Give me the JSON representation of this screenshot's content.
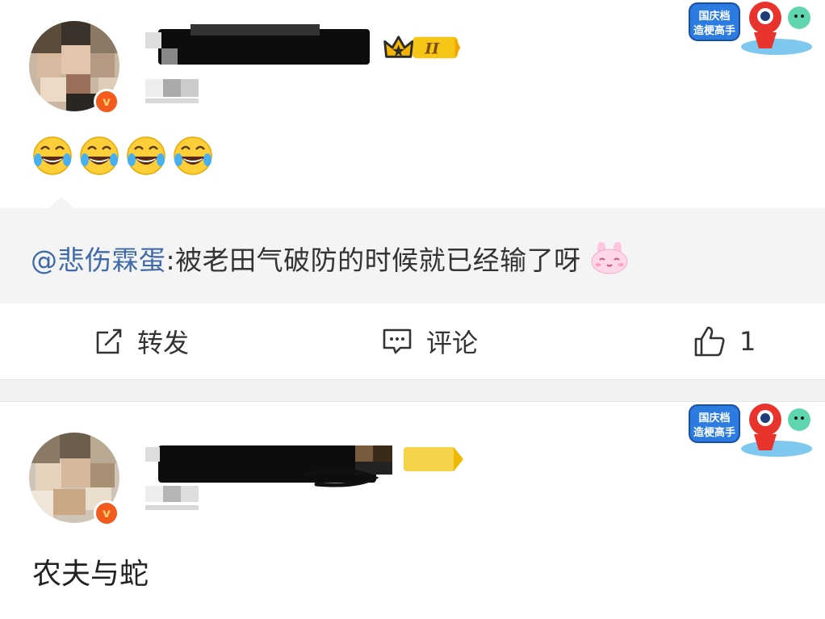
{
  "post1": {
    "user": {
      "level_badge": "II"
    },
    "emojis": [
      "laugh-cry",
      "laugh-cry",
      "laugh-cry",
      "laugh-cry"
    ],
    "quote": {
      "mention": "@悲伤霖蛋",
      "text": ":被老田气破防的时候就已经输了呀"
    },
    "actions": {
      "repost": "转发",
      "comment": "评论",
      "like_count": "1"
    },
    "promo_badge": {
      "line1": "国庆档",
      "line2": "造梗高手"
    }
  },
  "post2": {
    "text": "农夫与蛇",
    "promo_badge": {
      "line1": "国庆档",
      "line2": "造梗高手"
    }
  },
  "colors": {
    "mention": "#3f6aa8",
    "vip_orange": "#f25a1e",
    "crown_gold": "#f5c518"
  }
}
